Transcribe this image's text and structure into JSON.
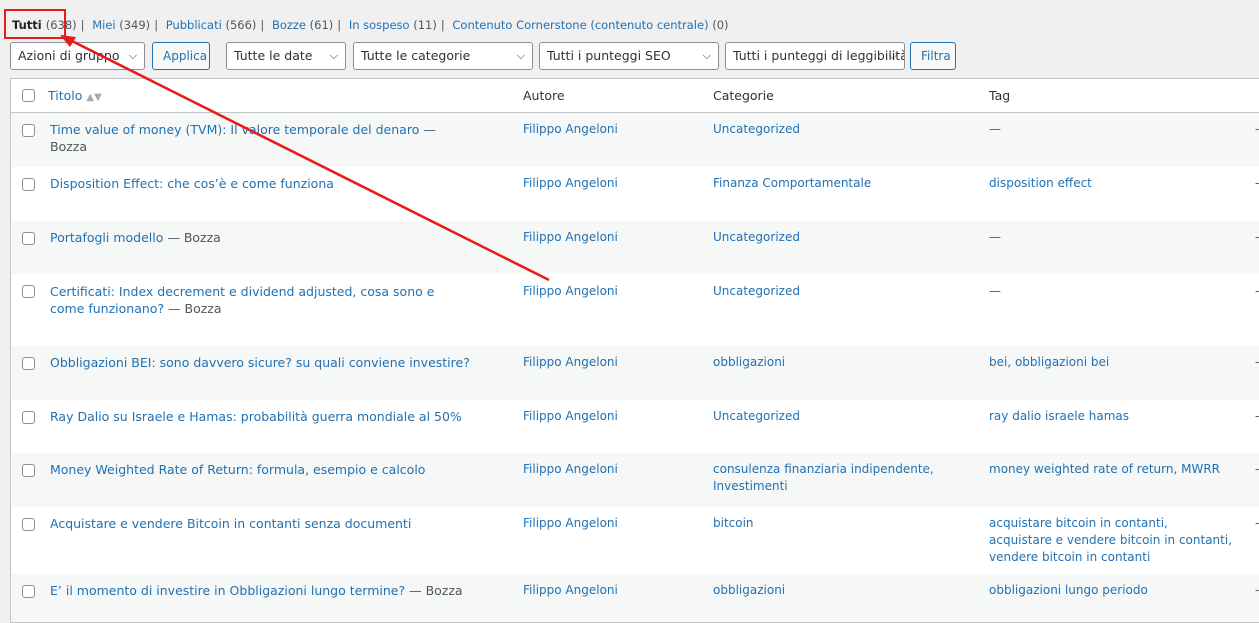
{
  "views": [
    {
      "label": "Tutti",
      "count": "(638)",
      "current": true
    },
    {
      "label": "Miei",
      "count": "(349)"
    },
    {
      "label": "Pubblicati",
      "count": "(566)"
    },
    {
      "label": "Bozze",
      "count": "(61)"
    },
    {
      "label": "In sospeso",
      "count": "(11)"
    },
    {
      "label": "Contenuto Cornerstone (contenuto centrale)",
      "count": "(0)"
    }
  ],
  "separator": "|",
  "filters": {
    "bulk_actions": "Azioni di gruppo",
    "apply": "Applica",
    "dates": "Tutte le date",
    "categories": "Tutte le categorie",
    "seo_scores": "Tutti i punteggi SEO",
    "readability_scores": "Tutti i punteggi di leggibilità",
    "filter": "Filtra"
  },
  "columns": {
    "title": "Titolo",
    "author": "Autore",
    "categories": "Categorie",
    "tags": "Tag"
  },
  "dash": "—",
  "edge_dash": "-",
  "posts": [
    {
      "title": "Time value of money (TVM): Il valore temporale del denaro",
      "state": " — Bozza",
      "author": "Filippo Angeloni",
      "categories": "Uncategorized",
      "tags": "—"
    },
    {
      "title": "Disposition Effect: che cos’è e come funziona",
      "state": "",
      "author": "Filippo Angeloni",
      "categories": "Finanza Comportamentale",
      "tags": "disposition effect"
    },
    {
      "title": "Portafogli modello",
      "state": " — Bozza",
      "author": "Filippo Angeloni",
      "categories": "Uncategorized",
      "tags": "—"
    },
    {
      "title": "Certificati: Index decrement e dividend adjusted, cosa sono e come funzionano?",
      "state": " — Bozza",
      "author": "Filippo Angeloni",
      "categories": "Uncategorized",
      "tags": "—"
    },
    {
      "title": "Obbligazioni BEI: sono davvero sicure? su quali conviene investire?",
      "state": "",
      "author": "Filippo Angeloni",
      "categories": "obbligazioni",
      "tags": "bei, obbligazioni bei"
    },
    {
      "title": "Ray Dalio su Israele e Hamas: probabilità guerra mondiale al 50%",
      "state": "",
      "author": "Filippo Angeloni",
      "categories": "Uncategorized",
      "tags": "ray dalio israele hamas"
    },
    {
      "title": "Money Weighted Rate of Return: formula, esempio e calcolo",
      "state": "",
      "author": "Filippo Angeloni",
      "categories": "consulenza finanziaria indipendente, Investimenti",
      "tags": "money weighted rate of return, MWRR"
    },
    {
      "title": "Acquistare e vendere Bitcoin in contanti senza documenti",
      "state": "",
      "author": "Filippo Angeloni",
      "categories": "bitcoin",
      "tags": "acquistare bitcoin in contanti, acquistare e vendere bitcoin in contanti, vendere bitcoin in contanti"
    },
    {
      "title": "E’ il momento di investire in Obbligazioni lungo termine?",
      "state": " — Bozza",
      "author": "Filippo Angeloni",
      "categories": "obbligazioni",
      "tags": "obbligazioni lungo periodo"
    }
  ]
}
